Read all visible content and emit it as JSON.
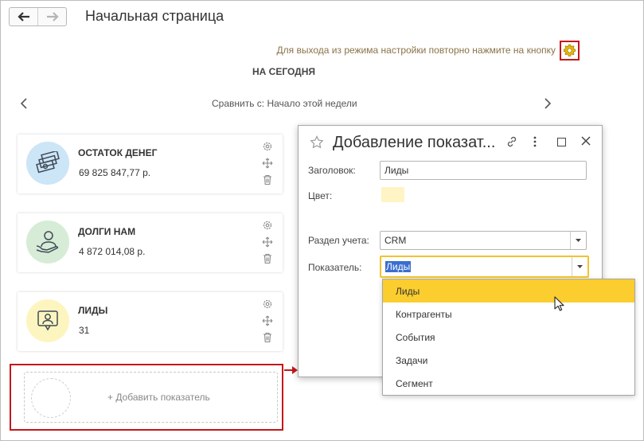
{
  "header": {
    "title": "Начальная страница"
  },
  "hint": {
    "text": "Для выхода из режима настройки повторно нажмите на кнопку"
  },
  "period": {
    "title": "НА СЕГОДНЯ",
    "compare": "Сравнить с: Начало этой недели"
  },
  "tiles": [
    {
      "title": "ОСТАТОК ДЕНЕГ",
      "value": "69 825 847,77 р.",
      "icon": "money-stack-icon",
      "color": "#cce5f7"
    },
    {
      "title": "ДОЛГИ НАМ",
      "value": "4 872 014,08 р.",
      "icon": "person-hand-icon",
      "color": "#d6ecd6"
    },
    {
      "title": "ЛИДЫ",
      "value": "31",
      "icon": "lead-monitor-icon",
      "color": "#fdf5c0"
    }
  ],
  "add_tile": {
    "label": "+ Добавить показатель"
  },
  "dialog": {
    "title": "Добавление показат...",
    "fields": {
      "heading": {
        "label": "Заголовок:",
        "value": "Лиды"
      },
      "color": {
        "label": "Цвет:",
        "value": "#fef4c4"
      },
      "section": {
        "label": "Раздел учета:",
        "value": "CRM"
      },
      "indicator": {
        "label": "Показатель:",
        "value": "Лиды"
      }
    }
  },
  "dropdown": {
    "options": [
      "Лиды",
      "Контрагенты",
      "События",
      "Задачи",
      "Сегмент"
    ],
    "selected": "Лиды"
  },
  "colors": {
    "accent": "#fbcd2e",
    "highlight_frame": "#c4171b",
    "hint_text": "#8a7348"
  }
}
